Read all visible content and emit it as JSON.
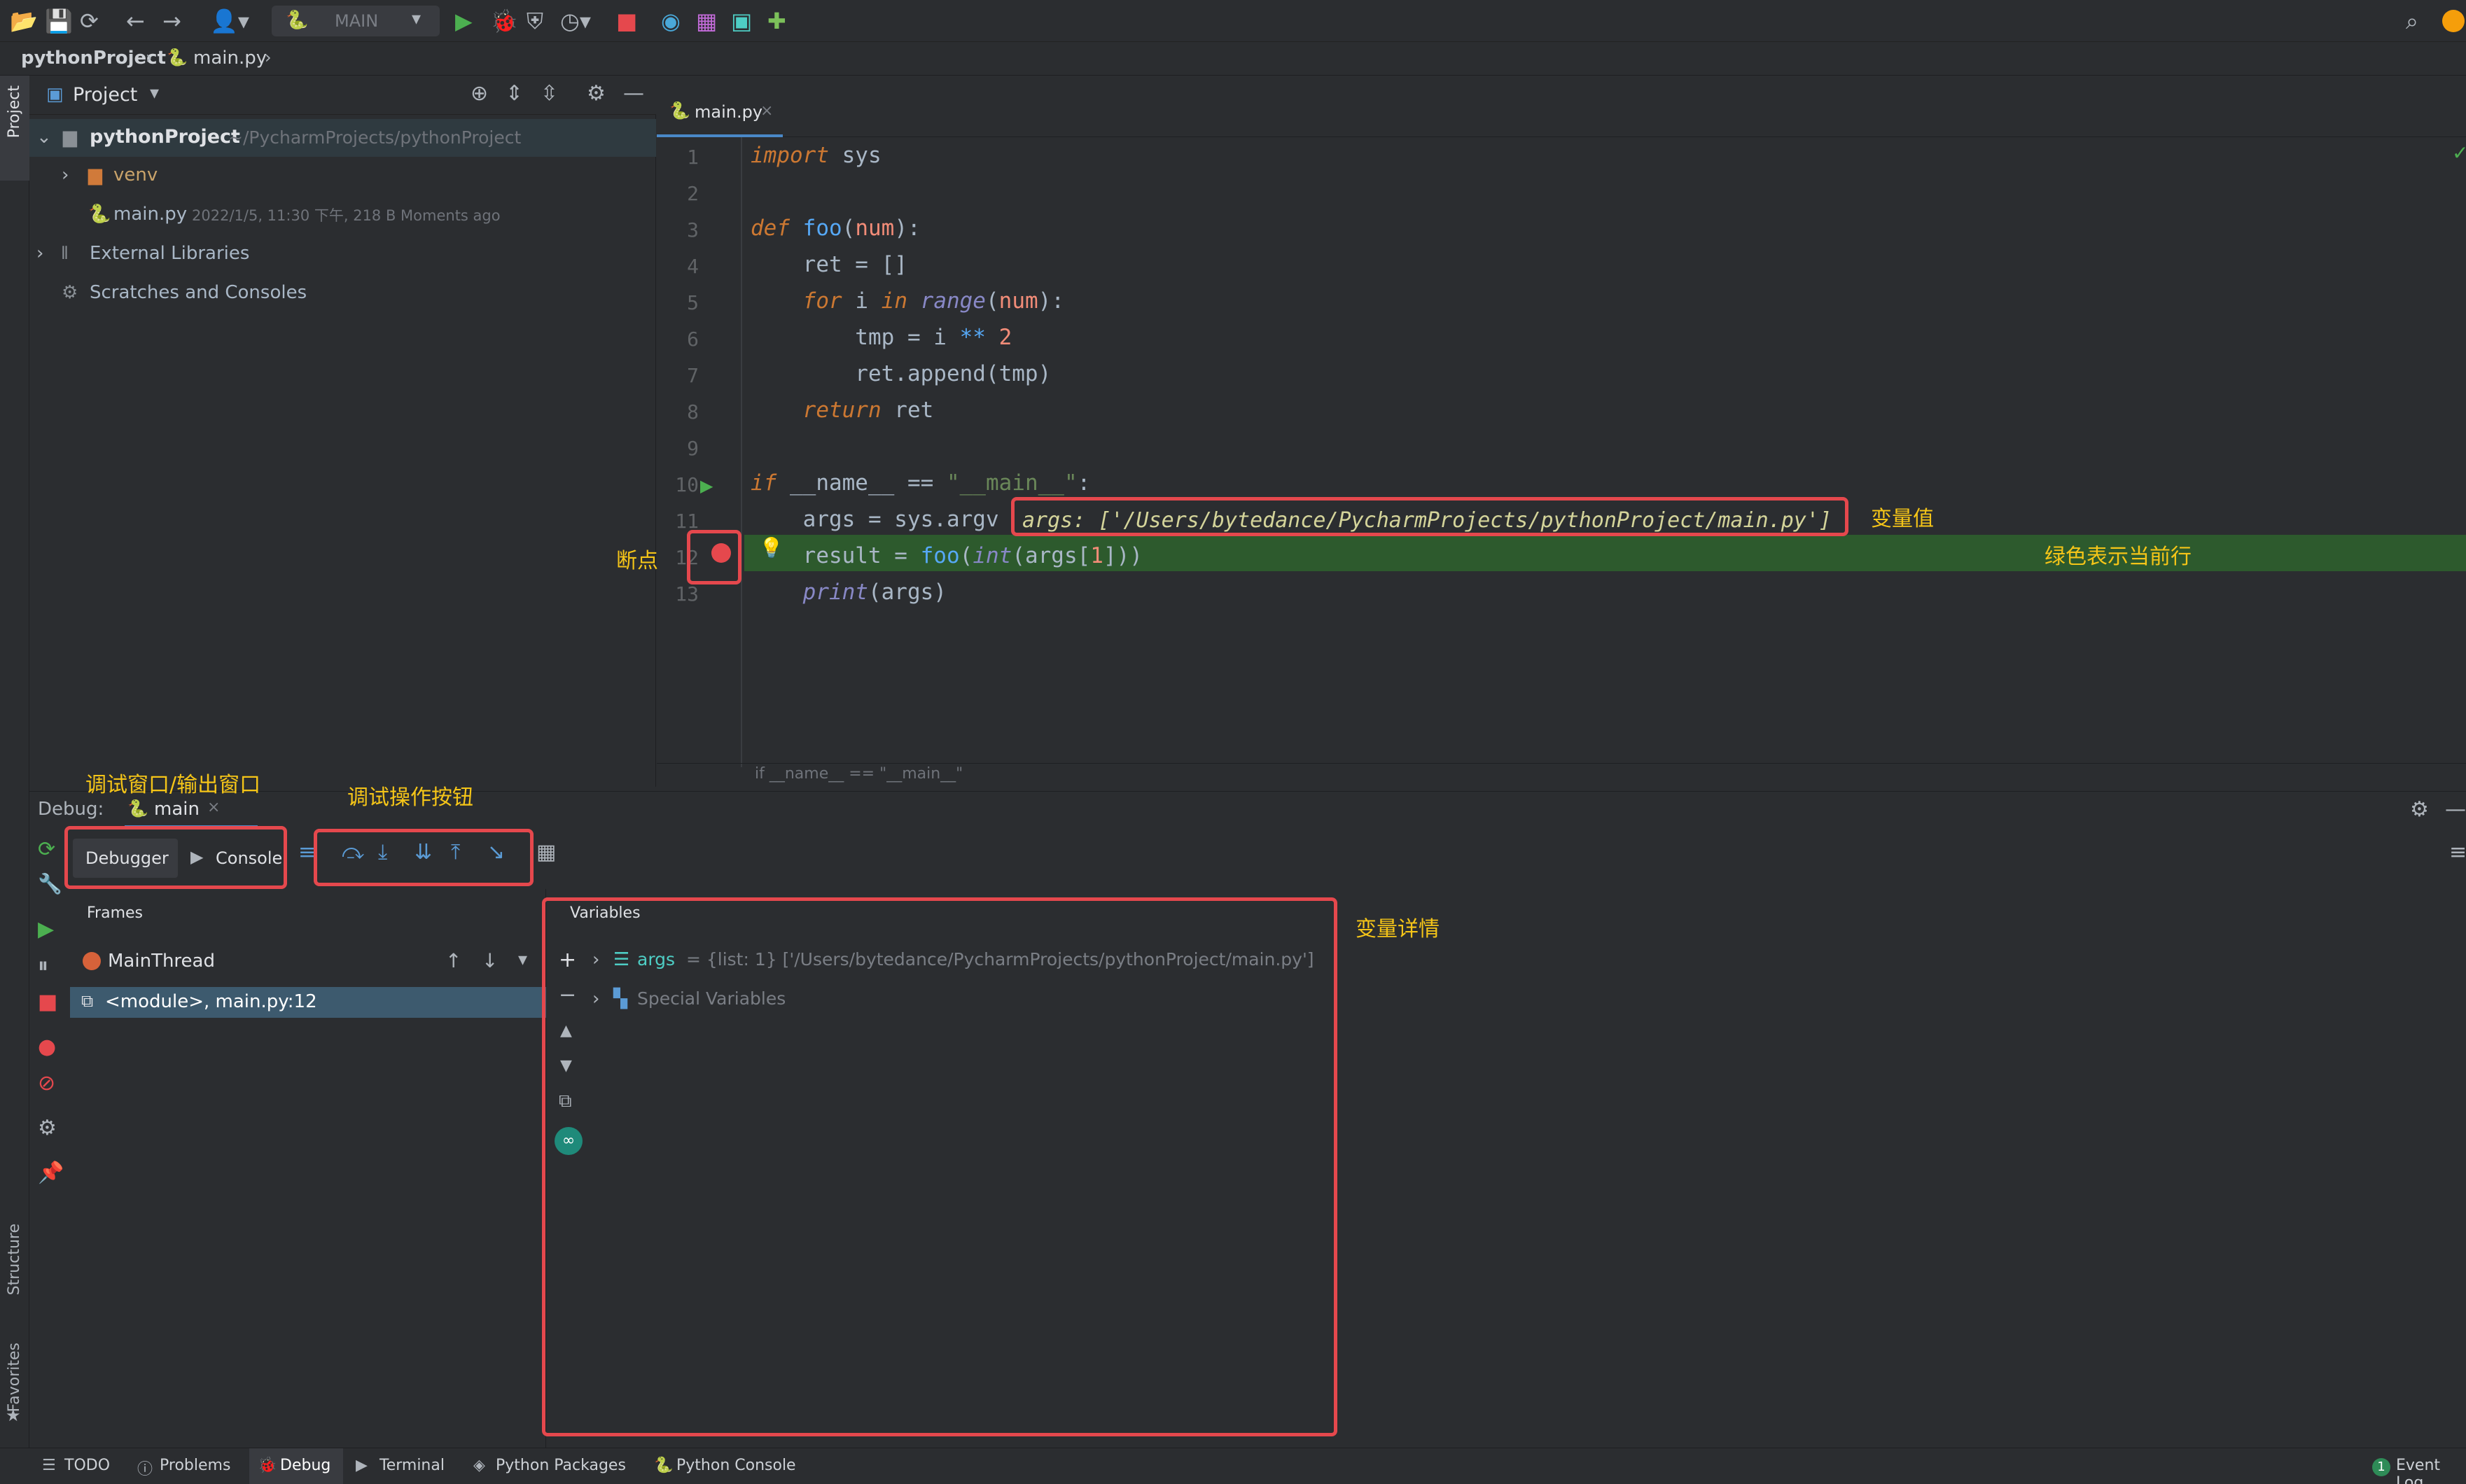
{
  "toolbar": {
    "run_config": "MAIN"
  },
  "breadcrumbs": {
    "project": "pythonProject",
    "file": "main.py"
  },
  "left_strip": {
    "project_label": "Project",
    "structure_label": "Structure",
    "favorites_label": "Favorites"
  },
  "project_panel": {
    "title": "Project",
    "root_name": "pythonProject",
    "root_path": "~/PycharmProjects/pythonProject",
    "venv": "venv",
    "file_name": "main.py",
    "file_meta": "2022/1/5, 11:30 下午, 218 B Moments ago",
    "external_libraries": "External Libraries",
    "scratches": "Scratches and Consoles"
  },
  "editor": {
    "tab": "main.py",
    "status_path": "if __name__ == \"__main__\"",
    "inline_value": "args: ['/Users/bytedance/PycharmProjects/pythonProject/main.py']",
    "line_numbers": [
      "1",
      "2",
      "3",
      "4",
      "5",
      "6",
      "7",
      "8",
      "9",
      "10",
      "11",
      "12",
      "13"
    ]
  },
  "annotations": {
    "variable_value": "变量值",
    "breakpoint": "断点",
    "current_line": "绿色表示当前行",
    "debug_window": "调试窗口/输出窗口",
    "debug_buttons": "调试操作按钮",
    "variable_detail": "变量详情"
  },
  "debug": {
    "label": "Debug:",
    "session": "main",
    "tab_debugger": "Debugger",
    "tab_console": "Console",
    "frames_title": "Frames",
    "thread": "MainThread",
    "frame": "<module>, main.py:12",
    "variables_title": "Variables",
    "var_name": "args",
    "var_value": " = {list: 1} ['/Users/bytedance/PycharmProjects/pythonProject/main.py']",
    "special_vars": "Special Variables"
  },
  "bottom_bar": {
    "todo": "TODO",
    "problems": "Problems",
    "debug": "Debug",
    "terminal": "Terminal",
    "python_packages": "Python Packages",
    "python_console": "Python Console",
    "event_log": "Event Log",
    "event_count": "1"
  },
  "colors": {
    "current_line": "#2d5a2d",
    "breakpoint": "#e5484d",
    "annotation": "#f5c518",
    "highlight_box": "#e5484d"
  }
}
